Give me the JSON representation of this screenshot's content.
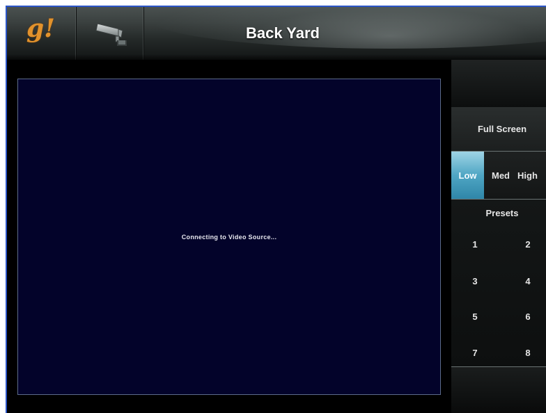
{
  "header": {
    "logo_text": "g!",
    "camera_icon": "security-camera-icon",
    "title": "Back Yard"
  },
  "video": {
    "status_text": "Connecting to Video Source..."
  },
  "controls": {
    "full_screen_label": "Full Screen",
    "quality": {
      "options": [
        "Low",
        "Med",
        "High"
      ],
      "selected": "Low"
    },
    "presets_title": "Presets",
    "presets": [
      "1",
      "2",
      "3",
      "4",
      "5",
      "6",
      "7",
      "8"
    ]
  },
  "colors": {
    "accent_selected": "#4fa6c4",
    "logo": "#e2922c",
    "video_bg": "#03032a",
    "window_border": "#2b55c8"
  }
}
